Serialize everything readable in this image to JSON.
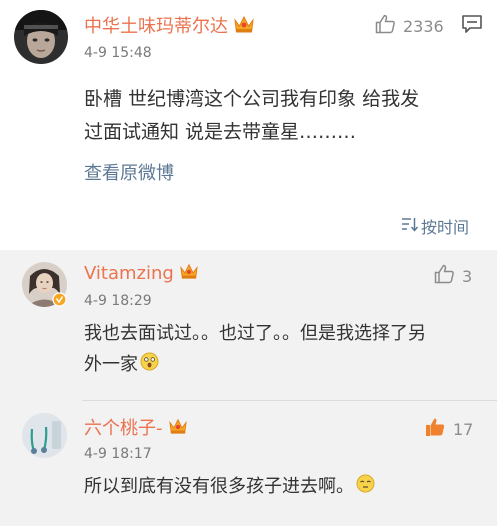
{
  "main_comment": {
    "username": "中华土味玛蒂尔达",
    "time": "4-9 15:48",
    "likes": "2336",
    "text_line1": "卧槽 世纪博湾这个公司我有印象 给我发",
    "text_line2": "过面试通知 说是去带童星………",
    "view_original_label": "查看原微博",
    "sort_label": "按时间"
  },
  "replies": [
    {
      "username": "Vitamzing",
      "time": "4-9 18:29",
      "likes": "3",
      "text_line1": "我也去面试过。。也过了。。但是我选择了另",
      "text_line2": "外一家"
    },
    {
      "username": "六个桃子-",
      "time": "4-9 18:17",
      "likes": "17",
      "text_line1": "所以到底有没有很多孩子进去啊。"
    }
  ],
  "colors": {
    "username": "#eb7350",
    "link": "#5d7895",
    "like_active": "#f0822d",
    "like_default": "#8c8c8c"
  },
  "icons": {
    "vip": "crown-vip-icon",
    "like": "thumbs-up-icon",
    "message": "comment-icon",
    "sort": "sort-icon"
  }
}
